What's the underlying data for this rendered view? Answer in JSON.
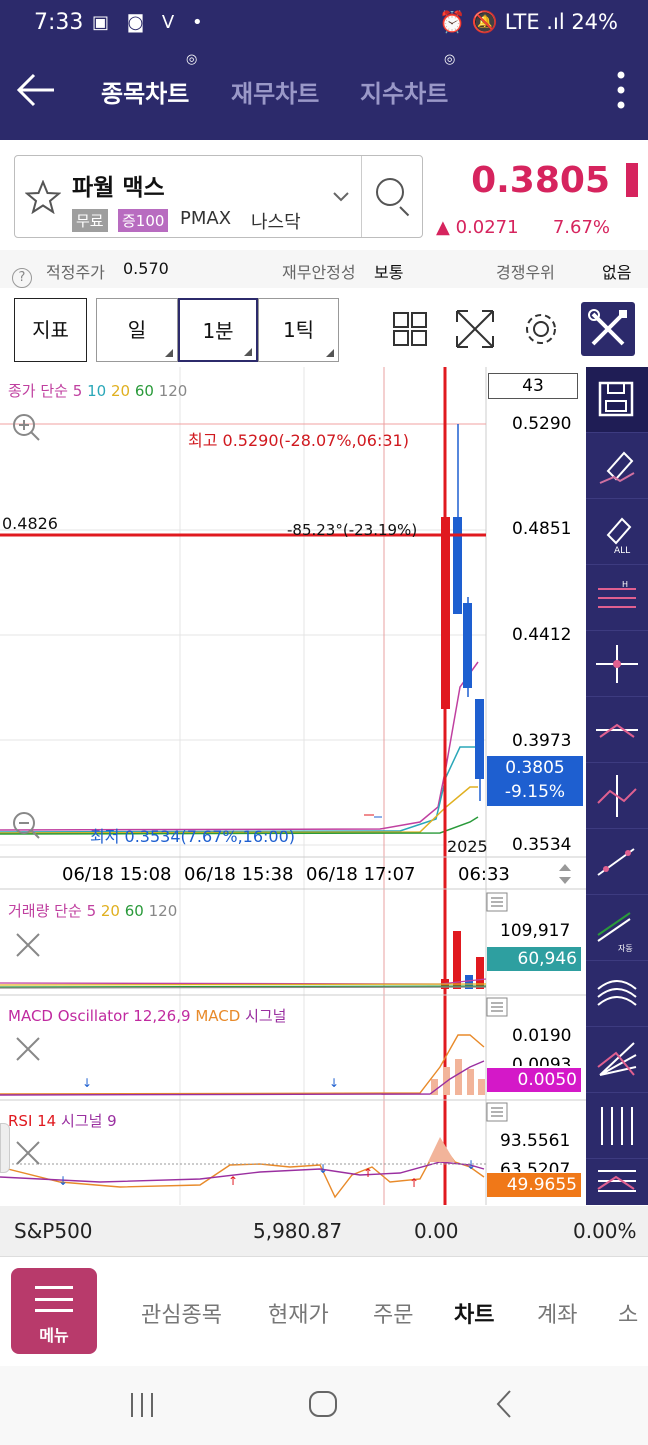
{
  "status": {
    "time": "7:33",
    "icons_left": "▣ ◙ V •",
    "right": "⏰ 🔕 LTE .ıl 24%"
  },
  "header": {
    "back_icon": "left-arrow-icon",
    "tabs": [
      {
        "label": "종목차트",
        "active": true
      },
      {
        "label": "재무차트",
        "active": false
      },
      {
        "label": "지수차트",
        "active": false
      }
    ]
  },
  "stock": {
    "name": "파월 맥스",
    "tag_free": "무료",
    "tag_margin": "증100",
    "code": "PMAX",
    "market": "나스닥",
    "price": "0.3805",
    "change": "▲ 0.0271",
    "change_pct": "7.67%",
    "accent": "#d6245e"
  },
  "info": {
    "fair_label": "적정주가",
    "fair_value": "0.570",
    "stability_label": "재무안정성",
    "stability_value": "보통",
    "competition_label": "경쟁우위",
    "competition_value": "없음"
  },
  "toolbar": {
    "indicator": "지표",
    "day": "일",
    "minute": "1분",
    "tick": "1틱"
  },
  "chart": {
    "price_legend": {
      "prefix": "종가 단순",
      "p5": "5",
      "p10": "10",
      "p20": "20",
      "p60": "60",
      "p120": "120"
    },
    "count": "43",
    "price_axis": [
      "0.5290",
      "0.4851",
      "0.4412",
      "0.3973",
      "0.3534"
    ],
    "current_price": "0.3805",
    "current_pct": "-9.15%",
    "high_note": "최고 0.5290(-28.07%,06:31)",
    "low_note": "최저 0.3534(7.67%,16:00)",
    "crosshair_value": "0.4826",
    "angle_note": "-85.23°(-23.19%)",
    "year_label": "2025",
    "time_axis": [
      "06/18 15:08",
      "06/18 15:38",
      "06/18 17:07"
    ],
    "cursor_time": "06:33",
    "volume_legend": {
      "prefix": "거래량 단순",
      "p5": "5",
      "p20": "20",
      "p60": "60",
      "p120": "120"
    },
    "volume_axis": "109,917",
    "volume_current": "60,946",
    "macd_legend": {
      "a": "MACD Oscillator 12,26,9",
      "b": "MACD",
      "c": "시그널"
    },
    "macd_axis": [
      "0.0190",
      "0.0093"
    ],
    "macd_current": "0.0050",
    "rsi_legend": {
      "a": "RSI 14",
      "b": "시그널 9"
    },
    "rsi_axis": [
      "93.5561",
      "63.5207"
    ],
    "rsi_current": "49.9655"
  },
  "index_bar": {
    "name": "S&P500",
    "value": "5,980.87",
    "change": "0.00",
    "pct": "0.00%"
  },
  "bottom_nav": {
    "menu": "메뉴",
    "items": [
      "관심종목",
      "현재가",
      "주문",
      "차트",
      "계좌",
      "소"
    ]
  }
}
